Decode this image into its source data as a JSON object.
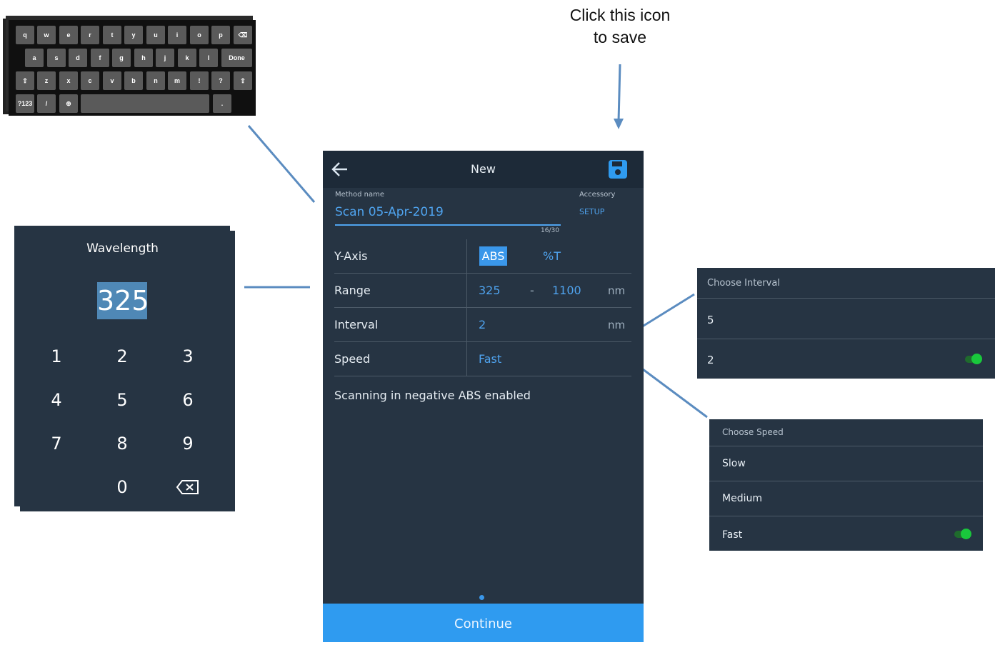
{
  "callout": {
    "line1": "Click this icon",
    "line2": "to save"
  },
  "keyboard": {
    "row1": [
      "q",
      "w",
      "e",
      "r",
      "t",
      "y",
      "u",
      "i",
      "o",
      "p",
      "⌫"
    ],
    "row2": [
      "a",
      "s",
      "d",
      "f",
      "g",
      "h",
      "j",
      "k",
      "l",
      "Done"
    ],
    "row3": [
      "⇧",
      "z",
      "x",
      "c",
      "v",
      "b",
      "n",
      "m",
      "!",
      "?",
      "⇧"
    ],
    "row4": [
      "?123",
      "/",
      "⊕",
      "",
      "."
    ]
  },
  "numpad": {
    "title": "Wavelength",
    "value": "325",
    "keys": [
      "1",
      "2",
      "3",
      "4",
      "5",
      "6",
      "7",
      "8",
      "9",
      "0",
      "⌫"
    ]
  },
  "phone": {
    "title": "New",
    "back_icon": "arrow-left-icon",
    "save_icon": "floppy-disk-icon",
    "method_label": "Method name",
    "method_value": "Scan 05-Apr-2019",
    "method_count": "16/30",
    "accessory_label": "Accessory",
    "accessory_setup": "SETUP",
    "rows": {
      "yaxis": {
        "label": "Y-Axis",
        "opt1": "ABS",
        "opt2": "%T"
      },
      "range": {
        "label": "Range",
        "start": "325",
        "dash": "-",
        "end": "1100",
        "unit": "nm"
      },
      "interval": {
        "label": "Interval",
        "value": "2",
        "unit": "nm"
      },
      "speed": {
        "label": "Speed",
        "value": "Fast"
      }
    },
    "negative_abs": "Scanning in negative ABS enabled",
    "continue": "Continue"
  },
  "interval_dialog": {
    "title": "Choose Interval",
    "items": [
      "5",
      "2"
    ],
    "selected": "2"
  },
  "speed_dialog": {
    "title": "Choose Speed",
    "items": [
      "Slow",
      "Medium",
      "Fast"
    ],
    "selected": "Fast"
  },
  "colors": {
    "panel": "#263443",
    "accent": "#2f9bf0",
    "toggle_on": "#19c83c"
  }
}
